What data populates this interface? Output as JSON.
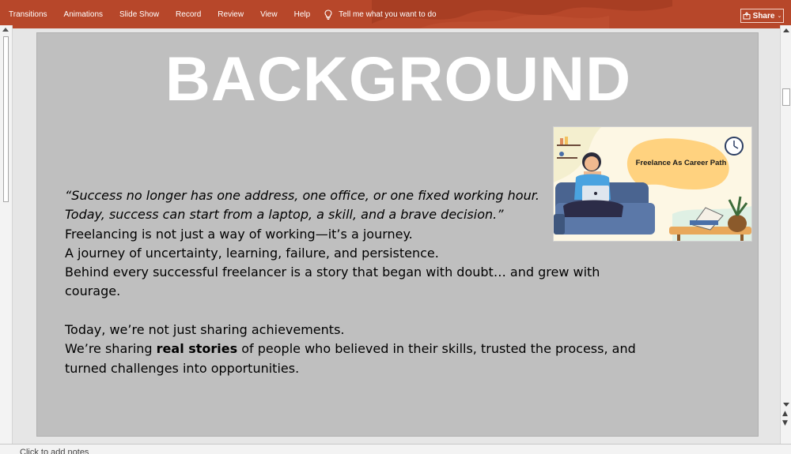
{
  "ribbon": {
    "tabs": [
      "Transitions",
      "Animations",
      "Slide Show",
      "Record",
      "Review",
      "View",
      "Help"
    ],
    "tell_me": "Tell me what you want to do",
    "share_label": "Share",
    "accent": "#b7472a"
  },
  "slide": {
    "title": "BACKGROUND",
    "background": "#bfbfbf",
    "quote_line_1": "“Success no longer has one address, one office, or one fixed working hour.",
    "quote_line_2": "Today, success can start from a laptop, a skill, and a brave decision.”",
    "para_line_1": "Freelancing is not just a way of working—it’s a journey.",
    "para_line_2": "A journey of uncertainty, learning, failure, and persistence.",
    "para_line_3": "Behind every successful freelancer is a story that began with doubt… and grew with",
    "para_line_4": "courage.",
    "para_line_5": "Today, we’re not just sharing achievements.",
    "para_line_6_before": "We’re sharing ",
    "para_line_6_bold": "real stories",
    "para_line_6_after": " of people who believed in their skills, trusted the process, and",
    "para_line_7": "turned challenges into opportunities.",
    "picture_caption": "Freelance As Career Path"
  },
  "notes": {
    "placeholder": "Click to add notes"
  },
  "icons": {
    "lightbulb": "lightbulb-icon",
    "share": "share-icon",
    "chevron": "chevron-down-icon"
  }
}
